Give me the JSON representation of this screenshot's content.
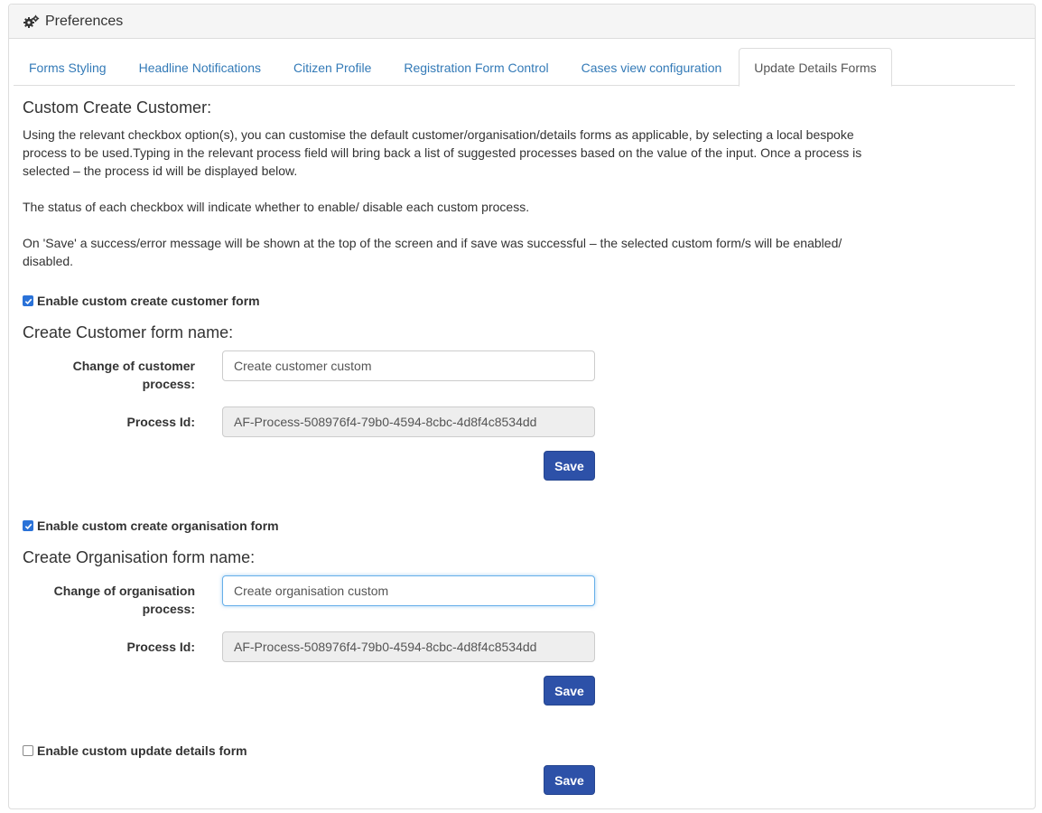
{
  "panel": {
    "title": "Preferences",
    "icon": "gears-icon"
  },
  "tabs": [
    {
      "label": "Forms Styling",
      "active": false
    },
    {
      "label": "Headline Notifications",
      "active": false
    },
    {
      "label": "Citizen Profile",
      "active": false
    },
    {
      "label": "Registration Form Control",
      "active": false
    },
    {
      "label": "Cases view configuration",
      "active": false
    },
    {
      "label": "Update Details Forms",
      "active": true
    }
  ],
  "content": {
    "heading": "Custom Create Customer:",
    "para1": "Using the relevant checkbox option(s), you can customise the default customer/organisation/details forms as applicable, by selecting a local bespoke process to be used.Typing in the relevant process field will bring back a list of suggested processes based on the value of the input. Once a process is selected – the process id will be displayed below.",
    "para2": "The status of each checkbox will indicate whether to enable/ disable each custom process.",
    "para3": "On 'Save' a success/error message will be shown at the top of the screen and if save was successful – the selected custom form/s will be enabled/ disabled."
  },
  "customer": {
    "checkbox_label": "Enable custom create customer form",
    "checked": true,
    "form_heading": "Create Customer form name:",
    "process_label": "Change of customer process:",
    "process_value": "Create customer custom",
    "id_label": "Process Id:",
    "id_value": "AF-Process-508976f4-79b0-4594-8cbc-4d8f4c8534dd",
    "save_label": "Save"
  },
  "organisation": {
    "checkbox_label": "Enable custom create organisation form",
    "checked": true,
    "form_heading": "Create Organisation form name:",
    "process_label": "Change of organisation process:",
    "process_value": "Create organisation custom",
    "id_label": "Process Id:",
    "id_value": "AF-Process-508976f4-79b0-4594-8cbc-4d8f4c8534dd",
    "save_label": "Save"
  },
  "update_details": {
    "checkbox_label": "Enable custom update details form",
    "checked": false,
    "save_label": "Save"
  },
  "colors": {
    "link": "#337ab7",
    "primary_button": "#2d51a8",
    "checkbox": "#2a72d8"
  }
}
